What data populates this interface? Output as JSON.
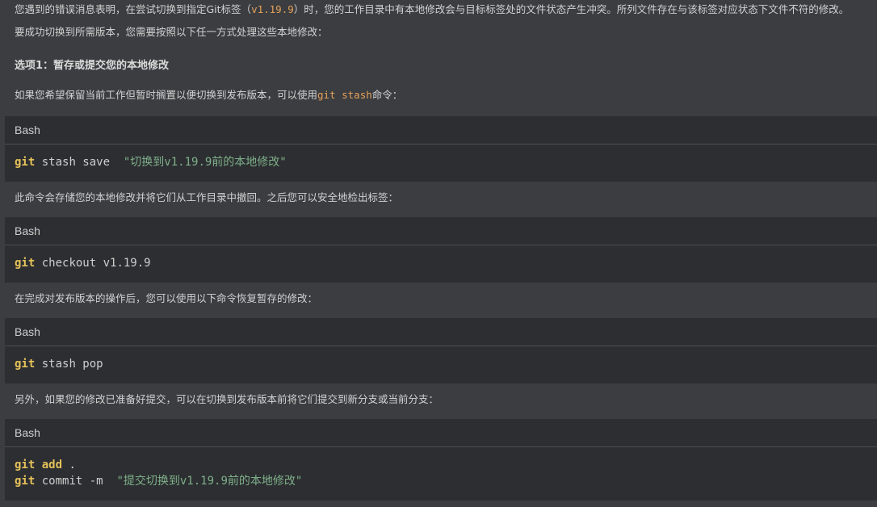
{
  "content": {
    "para1_parts": [
      "您遇到的错误消息表明，在尝试切换到指定Git标签（",
      "v1.19.9",
      "）时，您的工作目录中有本地修改会与目标标签处的文件状态产生冲突。所列文件存在与该标签对应状态下文件不符的修改。"
    ],
    "para2": "要成功切换到所需版本，您需要按照以下任一方式处理这些本地修改：",
    "heading": "选项1：暂存或提交您的本地修改",
    "para3_parts": [
      "如果您希望保留当前工作但暂时搁置以便切换到发布版本，可以使用",
      "git stash",
      "命令："
    ],
    "para4": "此命令会存储您的本地修改并将它们从工作目录中撤回。之后您可以安全地检出标签：",
    "para5": "在完成对发布版本的操作后，您可以使用以下命令恢复暂存的修改：",
    "para6": "另外，如果您的修改已准备好提交，可以在切换到发布版本前将它们提交到新分支或当前分支："
  },
  "code_blocks": [
    {
      "lang": "Bash",
      "lines": [
        [
          {
            "t": "git",
            "c": "kw"
          },
          {
            "t": " stash save  ",
            "c": "op"
          },
          {
            "t": "\"切换到v1.19.9前的本地修改\"",
            "c": "str"
          }
        ]
      ]
    },
    {
      "lang": "Bash",
      "lines": [
        [
          {
            "t": "git",
            "c": "kw"
          },
          {
            "t": " checkout v1.19.9",
            "c": "op"
          }
        ]
      ]
    },
    {
      "lang": "Bash",
      "lines": [
        [
          {
            "t": "git",
            "c": "kw"
          },
          {
            "t": " stash pop",
            "c": "op"
          }
        ]
      ]
    },
    {
      "lang": "Bash",
      "lines": [
        [
          {
            "t": "git",
            "c": "kw"
          },
          {
            "t": " ",
            "c": "op"
          },
          {
            "t": "add",
            "c": "kw"
          },
          {
            "t": " .",
            "c": "op"
          }
        ],
        [
          {
            "t": "git",
            "c": "kw"
          },
          {
            "t": " commit -m  ",
            "c": "op"
          },
          {
            "t": "\"提交切换到v1.19.9前的本地修改\"",
            "c": "str"
          }
        ]
      ]
    }
  ],
  "colors": {
    "background": "#3b3d40",
    "code_panel": "#2c2e31",
    "keyword": "#e5c15a",
    "string": "#7fb08a",
    "inline_code": "#e6a15a"
  }
}
